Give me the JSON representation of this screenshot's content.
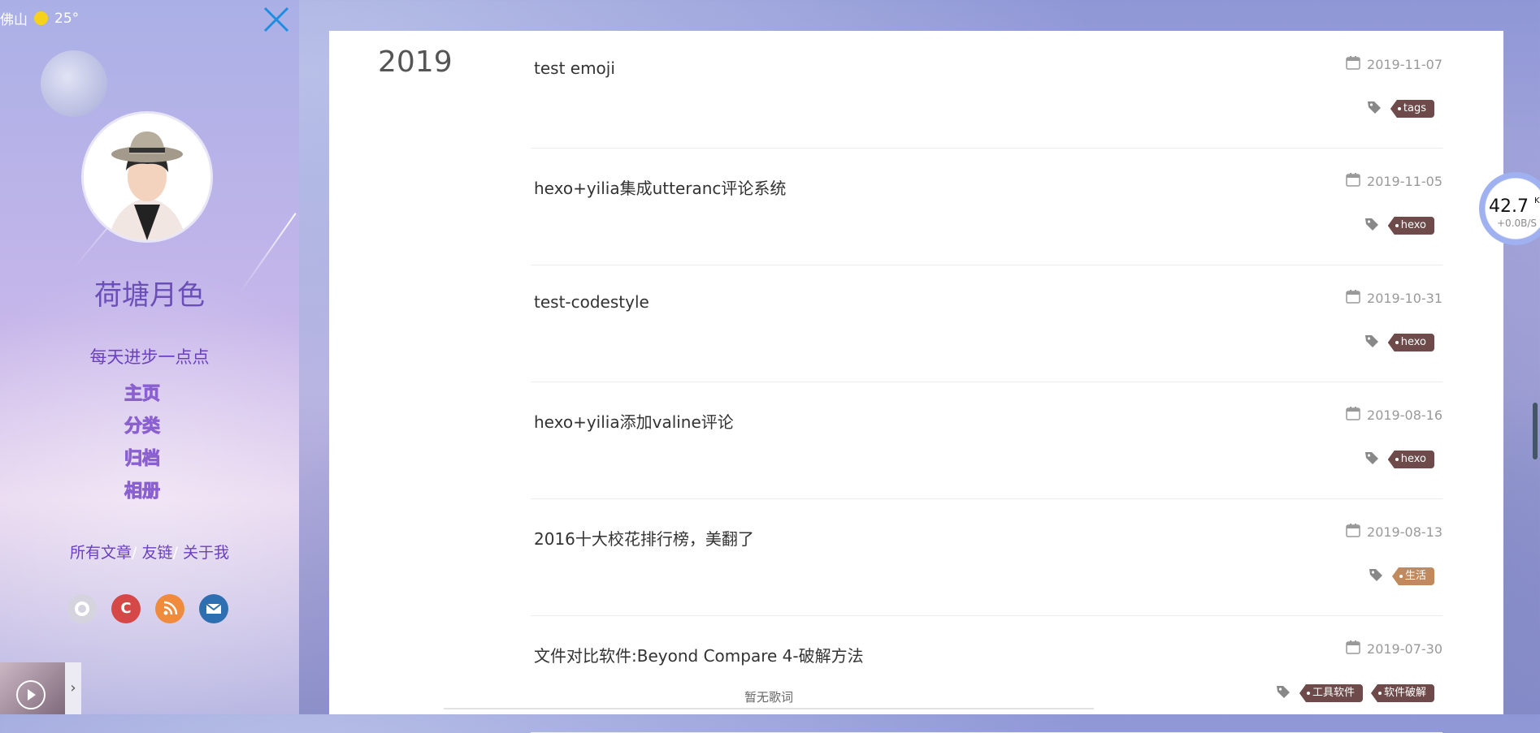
{
  "sidebar": {
    "weather": {
      "city": "佛山",
      "temp": "25°"
    },
    "site_title": "荷塘月色",
    "motto": "每天进步一点点",
    "nav": [
      {
        "label": "主页"
      },
      {
        "label": "分类"
      },
      {
        "label": "归档"
      },
      {
        "label": "相册"
      }
    ],
    "links": [
      {
        "label": "所有文章"
      },
      {
        "label": "友链"
      },
      {
        "label": "关于我"
      }
    ],
    "social": [
      {
        "icon": "github-icon",
        "color": "#d5d4de"
      },
      {
        "icon": "csdn-icon",
        "label": "C",
        "color": "#d64848"
      },
      {
        "icon": "rss-icon",
        "color": "#f08a3c"
      },
      {
        "icon": "mail-icon",
        "color": "#2d6fb0"
      }
    ]
  },
  "main": {
    "year": "2019",
    "posts": [
      {
        "title": "test emoji",
        "date": "2019-11-07",
        "tags": [
          "tags"
        ]
      },
      {
        "title": "hexo+yilia集成utteranc评论系统",
        "date": "2019-11-05",
        "tags": [
          "hexo"
        ]
      },
      {
        "title": "test-codestyle",
        "date": "2019-10-31",
        "tags": [
          "hexo"
        ]
      },
      {
        "title": "hexo+yilia添加valine评论",
        "date": "2019-08-16",
        "tags": [
          "hexo"
        ]
      },
      {
        "title": "2016十大校花排行榜，美翻了",
        "date": "2019-08-13",
        "tags": [
          "生活"
        ]
      },
      {
        "title": "文件对比软件:Beyond Compare 4-破解方法",
        "date": "2019-07-30",
        "tags": [
          "工具软件",
          "软件破解"
        ]
      }
    ],
    "lyrics": "暂无歌词"
  },
  "net_widget": {
    "speed": "42.7",
    "unit": "KB",
    "rate": "+0.0B/S"
  },
  "colors": {
    "tag": "#6e4a4a",
    "tag_life": "#c08a5e",
    "accent": "#6a40c0",
    "close": "#1f8ee0"
  }
}
